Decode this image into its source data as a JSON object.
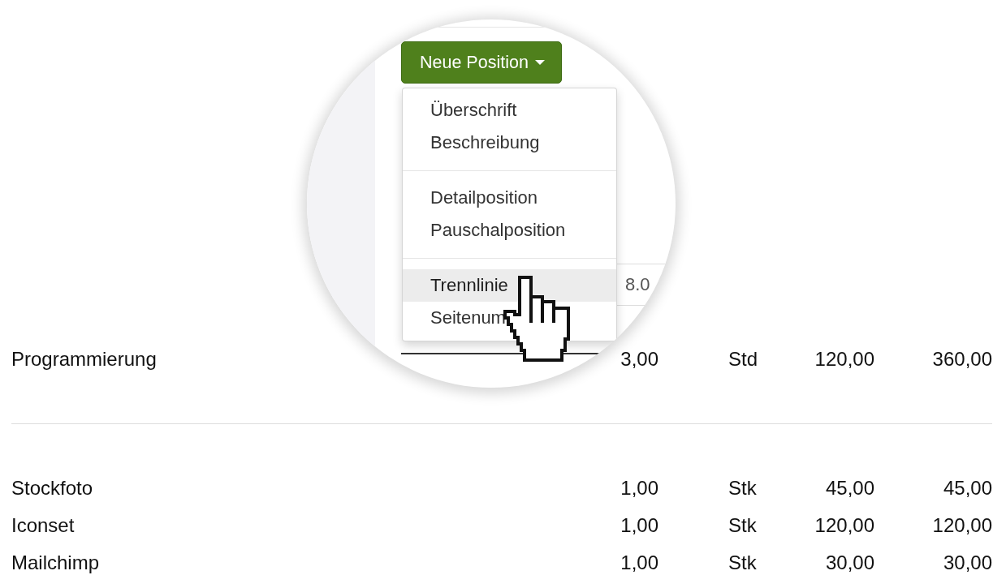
{
  "magnifier": {
    "new_position_button": {
      "label": "Neue Position",
      "expanded": true
    },
    "menu": {
      "groups": [
        {
          "items": [
            {
              "label": "Überschrift",
              "highlighted": false
            },
            {
              "label": "Beschreibung",
              "highlighted": false
            }
          ]
        },
        {
          "items": [
            {
              "label": "Detailposition",
              "highlighted": false
            },
            {
              "label": "Pauschalposition",
              "highlighted": false
            }
          ]
        },
        {
          "items": [
            {
              "label": "Trennlinie",
              "highlighted": true
            },
            {
              "label": "Seitenum",
              "highlighted": false
            }
          ]
        }
      ]
    },
    "background_cell": {
      "value": "8.0"
    }
  },
  "table": {
    "sections": [
      {
        "rows": [
          {
            "cells": [
              "Programmierung",
              "3,00",
              "Std",
              "120,00",
              "360,00"
            ]
          }
        ]
      },
      {
        "rows": [
          {
            "cells": [
              "Stockfoto",
              "1,00",
              "Stk",
              "45,00",
              "45,00"
            ]
          },
          {
            "cells": [
              "Iconset",
              "1,00",
              "Stk",
              "120,00",
              "120,00"
            ]
          },
          {
            "cells": [
              "Mailchimp",
              "1,00",
              "Stk",
              "30,00",
              "30,00"
            ]
          }
        ]
      }
    ]
  }
}
